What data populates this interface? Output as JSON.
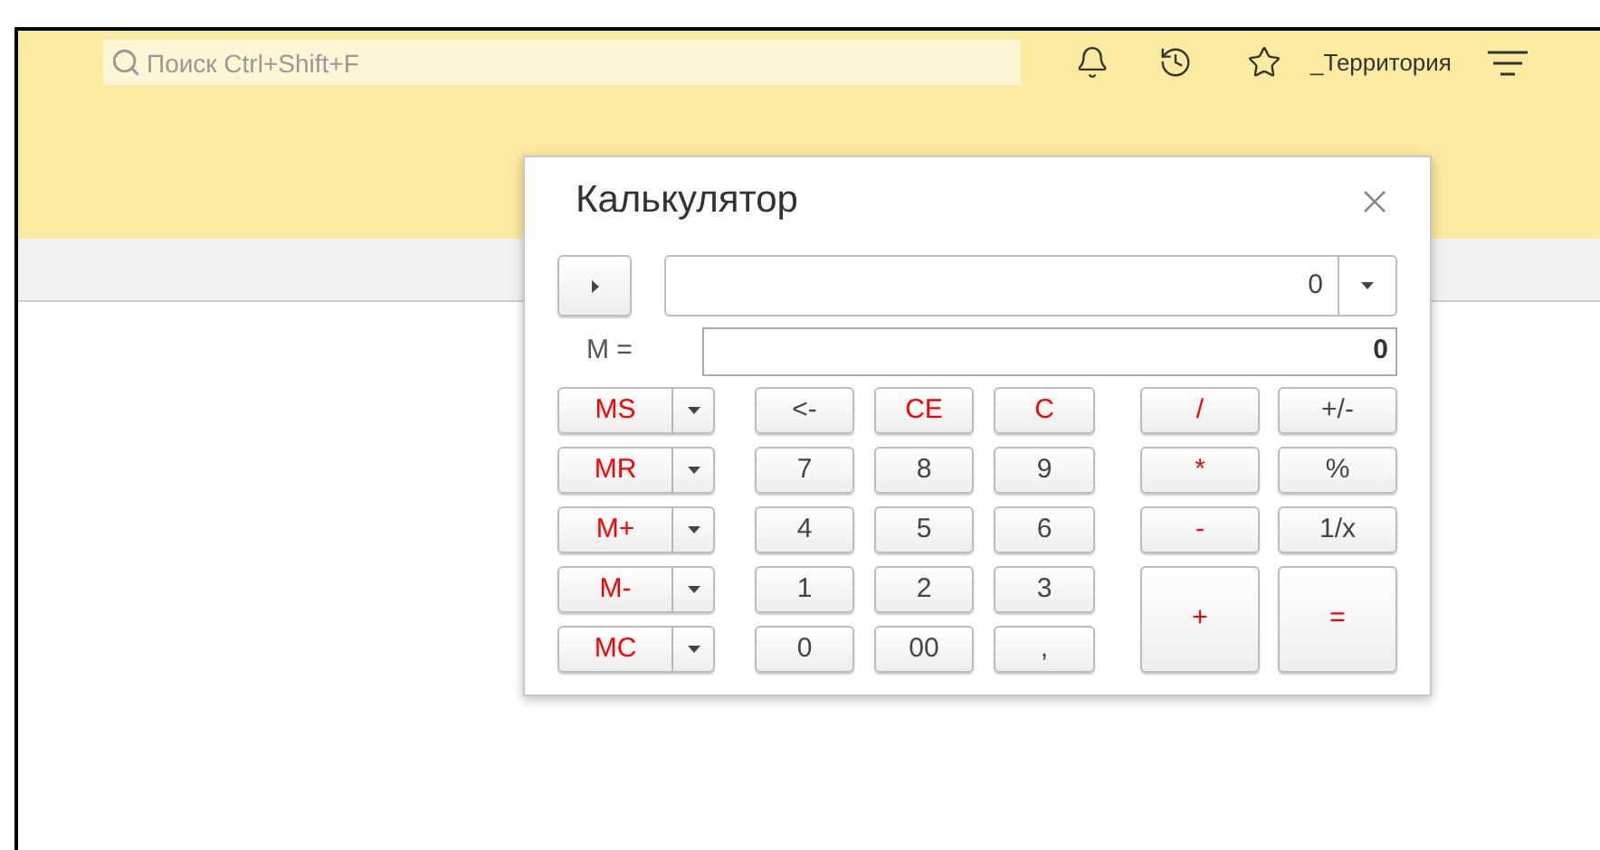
{
  "toolbar": {
    "search": {
      "placeholder": "Поиск Ctrl+Shift+F"
    },
    "user": "_Территория"
  },
  "dialog": {
    "title": "Калькулятор",
    "display": "0",
    "memory_label": "M =",
    "memory_value": "0",
    "memory_buttons": [
      {
        "label": "MS",
        "color": "#ff0000"
      },
      {
        "label": "MR",
        "color": "#ff0000"
      },
      {
        "label": "M+",
        "color": "#ff0000"
      },
      {
        "label": "M-",
        "color": "#ff0000"
      },
      {
        "label": "MC",
        "color": "#ff0000"
      }
    ],
    "keypad": [
      {
        "label": "<-",
        "color": "#444444"
      },
      {
        "label": "CE",
        "color": "#ff0000"
      },
      {
        "label": "C",
        "color": "#ff0000"
      },
      {
        "label": "7",
        "color": "#444444"
      },
      {
        "label": "8",
        "color": "#444444"
      },
      {
        "label": "9",
        "color": "#444444"
      },
      {
        "label": "4",
        "color": "#444444"
      },
      {
        "label": "5",
        "color": "#444444"
      },
      {
        "label": "6",
        "color": "#444444"
      },
      {
        "label": "1",
        "color": "#444444"
      },
      {
        "label": "2",
        "color": "#444444"
      },
      {
        "label": "3",
        "color": "#444444"
      },
      {
        "label": "0",
        "color": "#444444"
      },
      {
        "label": "00",
        "color": "#444444"
      },
      {
        "label": ",",
        "color": "#444444"
      }
    ],
    "operation_keys": [
      {
        "label": "/",
        "color": "#ff0000",
        "kind": "normal"
      },
      {
        "label": "+/-",
        "color": "#444444",
        "kind": "normal"
      },
      {
        "label": "*",
        "color": "#ff0000",
        "kind": "normal"
      },
      {
        "label": "%",
        "color": "#444444",
        "kind": "normal"
      },
      {
        "label": "-",
        "color": "#ff0000",
        "kind": "normal"
      },
      {
        "label": "1/x",
        "color": "#444444",
        "kind": "normal"
      },
      {
        "label": "+",
        "color": "#ff0000",
        "kind": "tall"
      },
      {
        "label": "=",
        "color": "#ff0000",
        "kind": "tall"
      }
    ]
  }
}
